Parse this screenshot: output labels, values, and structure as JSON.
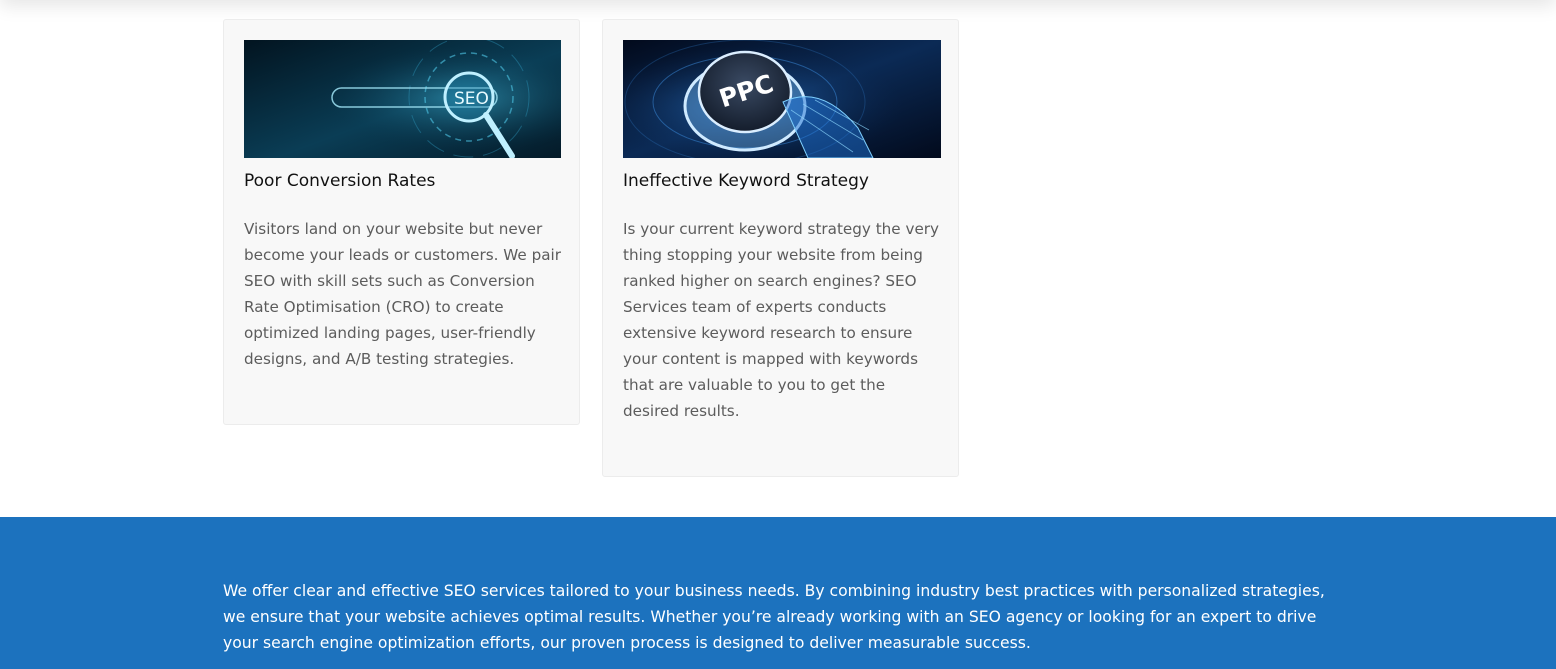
{
  "cards": [
    {
      "image_label": "SEO",
      "title": "Poor Conversion Rates",
      "text": "Visitors land on your website but never become your leads or customers. We pair SEO with skill sets such as Conversion Rate Optimisation (CRO) to create optimized landing pages, user-friendly designs, and A/B testing strategies."
    },
    {
      "image_label": "PPC",
      "title": "Ineffective Keyword Strategy",
      "text": "Is your current keyword strategy the very thing stopping your website from being ranked higher on search engines? SEO Services team of experts conducts extensive keyword research to ensure your content is mapped with keywords that are valuable to you to get the desired results."
    }
  ],
  "band": {
    "text": "We offer clear and effective SEO services tailored to your business needs. By combining industry best practices with personalized strategies, we ensure that your website achieves optimal results. Whether you’re already working with an SEO agency or looking for an expert to drive your search engine optimization efforts, our proven process is designed to deliver measurable success.",
    "color": "#1c72be"
  }
}
